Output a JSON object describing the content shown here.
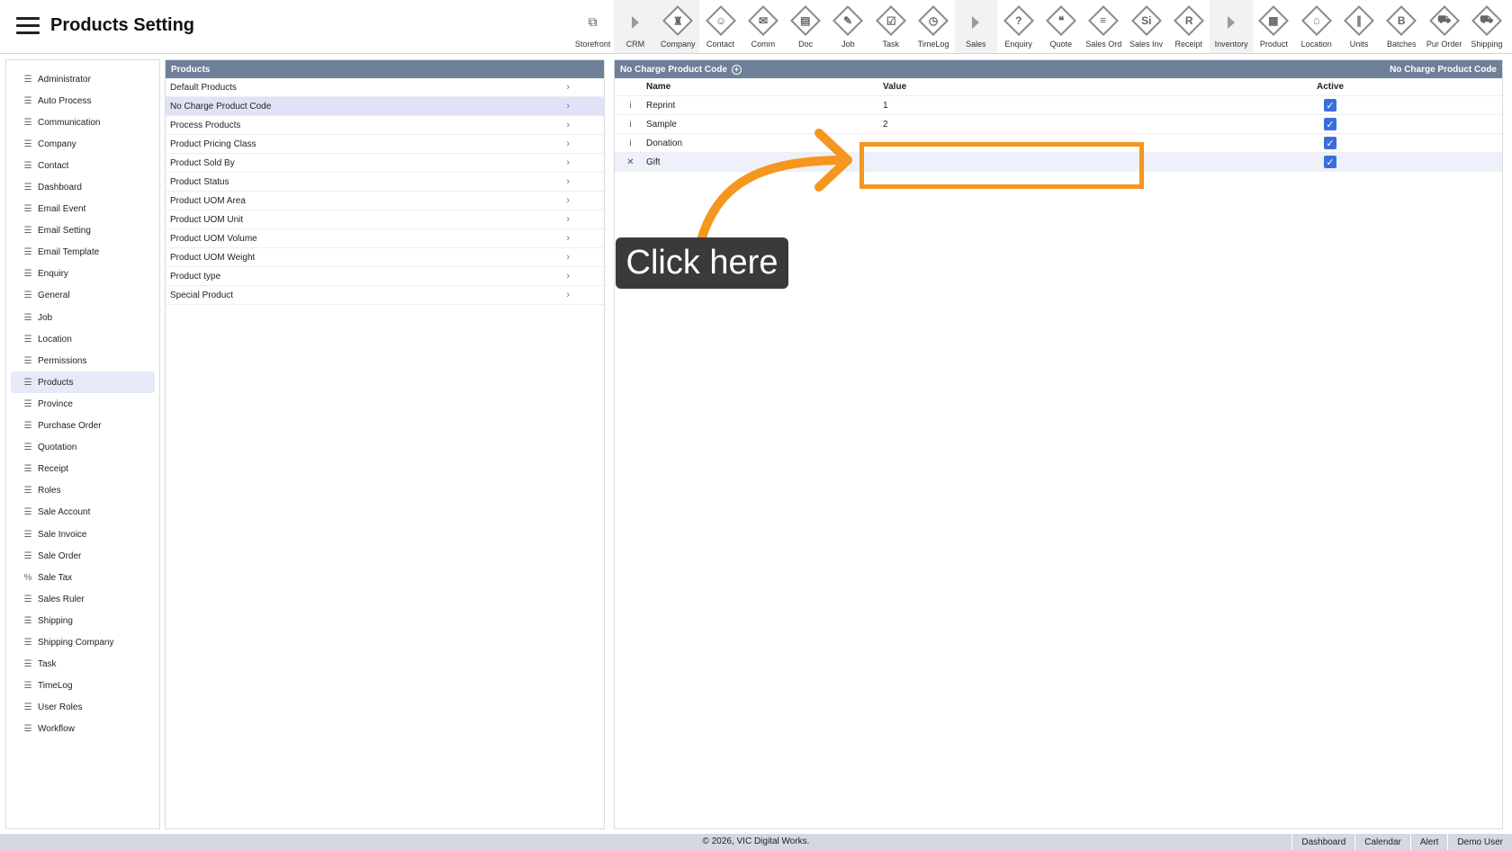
{
  "header": {
    "title": "Products Setting"
  },
  "toolbar": [
    {
      "label": "Storefront",
      "icon": "external-link-icon",
      "glyph": "⧉",
      "kind": "ext"
    },
    {
      "label": "CRM",
      "icon": "expand-arrow-icon",
      "glyph": "",
      "kind": "arrow",
      "group": true
    },
    {
      "label": "Company",
      "icon": "company-icon",
      "glyph": "♜",
      "kind": "diamond",
      "group": true
    },
    {
      "label": "Contact",
      "icon": "contact-icon",
      "glyph": "☺",
      "kind": "diamond"
    },
    {
      "label": "Comm",
      "icon": "comm-icon",
      "glyph": "✉",
      "kind": "diamond"
    },
    {
      "label": "Doc",
      "icon": "doc-icon",
      "glyph": "▤",
      "kind": "diamond"
    },
    {
      "label": "Job",
      "icon": "job-icon",
      "glyph": "✎",
      "kind": "diamond"
    },
    {
      "label": "Task",
      "icon": "task-icon",
      "glyph": "☑",
      "kind": "diamond"
    },
    {
      "label": "TimeLog",
      "icon": "clock-icon",
      "glyph": "◷",
      "kind": "diamond"
    },
    {
      "label": "Sales",
      "icon": "expand-arrow-icon",
      "glyph": "",
      "kind": "arrow",
      "group": true
    },
    {
      "label": "Enquiry",
      "icon": "enquiry-icon",
      "glyph": "?",
      "kind": "diamond"
    },
    {
      "label": "Quote",
      "icon": "quote-icon",
      "glyph": "❝",
      "kind": "diamond"
    },
    {
      "label": "Sales Ord",
      "icon": "sales-order-icon",
      "glyph": "≡",
      "kind": "diamond"
    },
    {
      "label": "Sales Inv",
      "icon": "sales-invoice-icon",
      "glyph": "Si",
      "kind": "diamond"
    },
    {
      "label": "Receipt",
      "icon": "receipt-icon",
      "glyph": "R",
      "kind": "diamond"
    },
    {
      "label": "Inventory",
      "icon": "expand-arrow-icon",
      "glyph": "",
      "kind": "arrow",
      "group": true
    },
    {
      "label": "Product",
      "icon": "product-icon",
      "glyph": "▦",
      "kind": "diamond"
    },
    {
      "label": "Location",
      "icon": "location-icon",
      "glyph": "⌂",
      "kind": "diamond"
    },
    {
      "label": "Units",
      "icon": "units-icon",
      "glyph": "∥",
      "kind": "diamond"
    },
    {
      "label": "Batches",
      "icon": "batches-icon",
      "glyph": "B",
      "kind": "diamond"
    },
    {
      "label": "Pur Order",
      "icon": "cart-icon",
      "glyph": "⛟",
      "kind": "diamond"
    },
    {
      "label": "Shipping",
      "icon": "truck-icon",
      "glyph": "⛟",
      "kind": "diamond"
    }
  ],
  "sidebar": {
    "items": [
      {
        "label": "Administrator",
        "icon": "list-icon"
      },
      {
        "label": "Auto Process",
        "icon": "list-icon"
      },
      {
        "label": "Communication",
        "icon": "list-icon"
      },
      {
        "label": "Company",
        "icon": "list-icon"
      },
      {
        "label": "Contact",
        "icon": "list-icon"
      },
      {
        "label": "Dashboard",
        "icon": "list-icon"
      },
      {
        "label": "Email Event",
        "icon": "list-icon"
      },
      {
        "label": "Email Setting",
        "icon": "list-icon"
      },
      {
        "label": "Email Template",
        "icon": "list-icon"
      },
      {
        "label": "Enquiry",
        "icon": "list-icon"
      },
      {
        "label": "General",
        "icon": "list-icon"
      },
      {
        "label": "Job",
        "icon": "list-icon"
      },
      {
        "label": "Location",
        "icon": "list-icon"
      },
      {
        "label": "Permissions",
        "icon": "list-icon"
      },
      {
        "label": "Products",
        "icon": "list-icon",
        "active": true
      },
      {
        "label": "Province",
        "icon": "list-icon"
      },
      {
        "label": "Purchase Order",
        "icon": "list-icon"
      },
      {
        "label": "Quotation",
        "icon": "list-icon"
      },
      {
        "label": "Receipt",
        "icon": "list-icon"
      },
      {
        "label": "Roles",
        "icon": "list-icon"
      },
      {
        "label": "Sale Account",
        "icon": "list-icon"
      },
      {
        "label": "Sale Invoice",
        "icon": "list-icon"
      },
      {
        "label": "Sale Order",
        "icon": "list-icon"
      },
      {
        "label": "Sale Tax",
        "icon": "percent-icon"
      },
      {
        "label": "Sales Ruler",
        "icon": "list-icon"
      },
      {
        "label": "Shipping",
        "icon": "list-icon"
      },
      {
        "label": "Shipping Company",
        "icon": "list-icon"
      },
      {
        "label": "Task",
        "icon": "list-icon"
      },
      {
        "label": "TimeLog",
        "icon": "list-icon"
      },
      {
        "label": "User Roles",
        "icon": "list-icon"
      },
      {
        "label": "Workflow",
        "icon": "list-icon"
      }
    ]
  },
  "products_panel": {
    "title": "Products",
    "items": [
      {
        "label": "Default Products"
      },
      {
        "label": "No Charge Product Code",
        "active": true
      },
      {
        "label": "Process Products"
      },
      {
        "label": "Product Pricing Class"
      },
      {
        "label": "Product Sold By"
      },
      {
        "label": "Product Status"
      },
      {
        "label": "Product UOM Area"
      },
      {
        "label": "Product UOM Unit"
      },
      {
        "label": "Product UOM Volume"
      },
      {
        "label": "Product UOM Weight"
      },
      {
        "label": "Product type"
      },
      {
        "label": "Special Product"
      }
    ]
  },
  "detail_panel": {
    "title": "No Charge Product Code",
    "title_right": "No Charge Product Code",
    "columns": {
      "name": "Name",
      "value": "Value",
      "active": "Active"
    },
    "rows": [
      {
        "action": "i",
        "name": "Reprint",
        "value": "1",
        "active": true
      },
      {
        "action": "i",
        "name": "Sample",
        "value": "2",
        "active": true
      },
      {
        "action": "i",
        "name": "Donation",
        "value": "",
        "active": true
      },
      {
        "action": "✕",
        "name": "Gift",
        "value": "",
        "active": true,
        "editing": true
      }
    ]
  },
  "annotation": {
    "tooltip": "Click here",
    "color": "#f5961f"
  },
  "footer": {
    "copyright": "© 2026, VIC Digital Works.",
    "links": [
      "Dashboard",
      "Calendar",
      "Alert",
      "Demo User"
    ]
  },
  "colors": {
    "panel_header": "#6e7f98",
    "checkbox": "#3a6fd8",
    "footer": "#d3d8e3"
  }
}
